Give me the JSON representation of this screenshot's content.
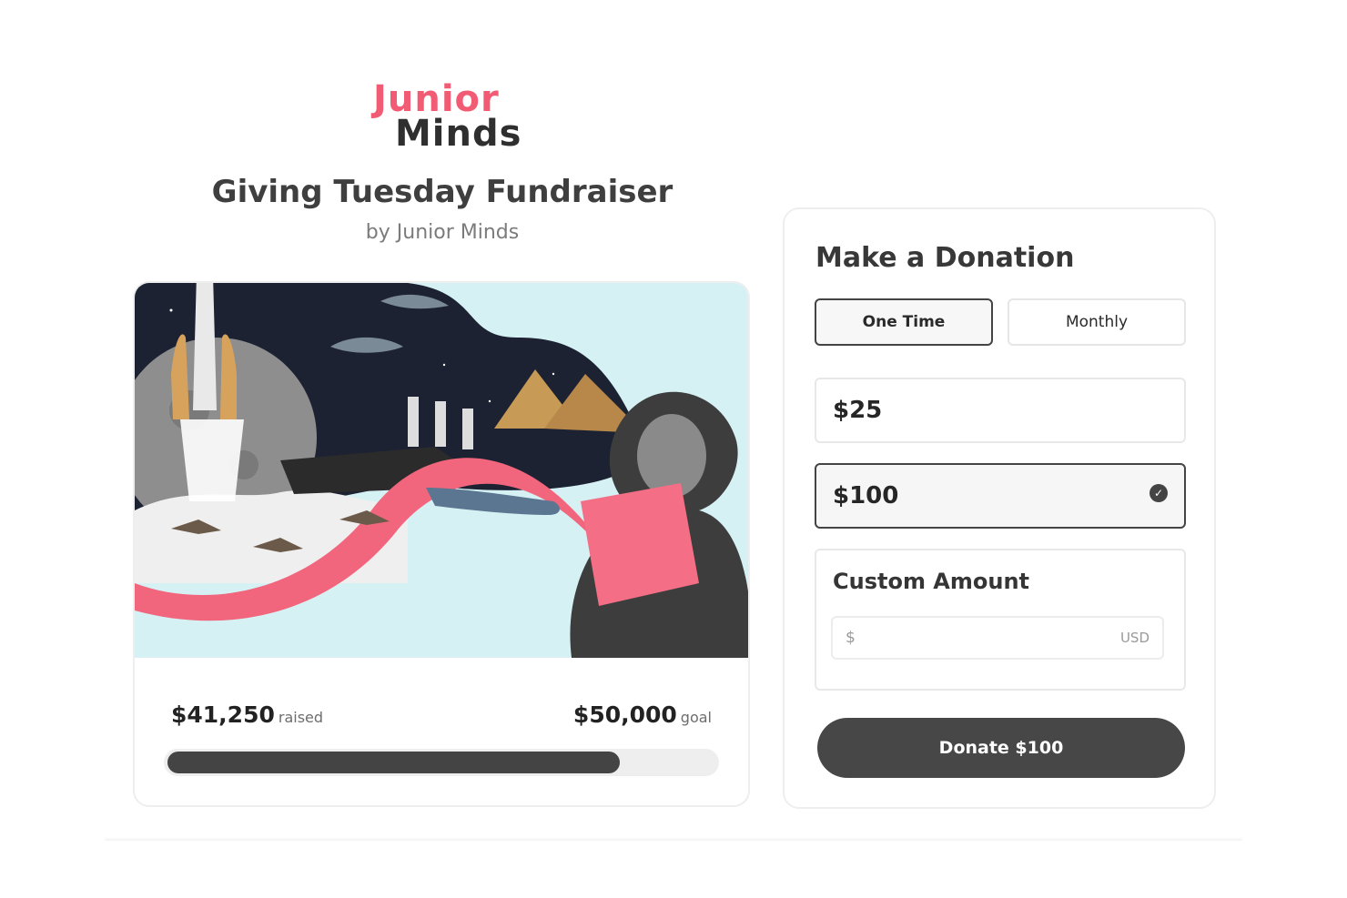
{
  "brand": {
    "logo_line1": "Junior",
    "logo_line2": "Minds",
    "logo_color_primary": "#f25b74",
    "logo_color_secondary": "#2f2f2f"
  },
  "campaign": {
    "title": "Giving Tuesday Fundraiser",
    "subtitle": "by Junior Minds",
    "hero_image": "collage-icon",
    "raised_value": "$41,250",
    "raised_label": "raised",
    "goal_value": "$50,000",
    "goal_label": "goal",
    "progress_fraction": 0.825
  },
  "donation": {
    "title": "Make a Donation",
    "frequency": {
      "one_time": "One Time",
      "monthly": "Monthly",
      "selected": "One Time"
    },
    "amounts": [
      {
        "label": "$25",
        "selected": false
      },
      {
        "label": "$100",
        "selected": true
      }
    ],
    "custom": {
      "label": "Custom Amount",
      "currency_symbol": "$",
      "currency_code": "USD",
      "value": ""
    },
    "submit_label": "Donate $100"
  },
  "colors": {
    "accent": "#444444",
    "track": "#eeeeee",
    "ribbon": "#f2667d",
    "sky": "#d5f1f4"
  }
}
